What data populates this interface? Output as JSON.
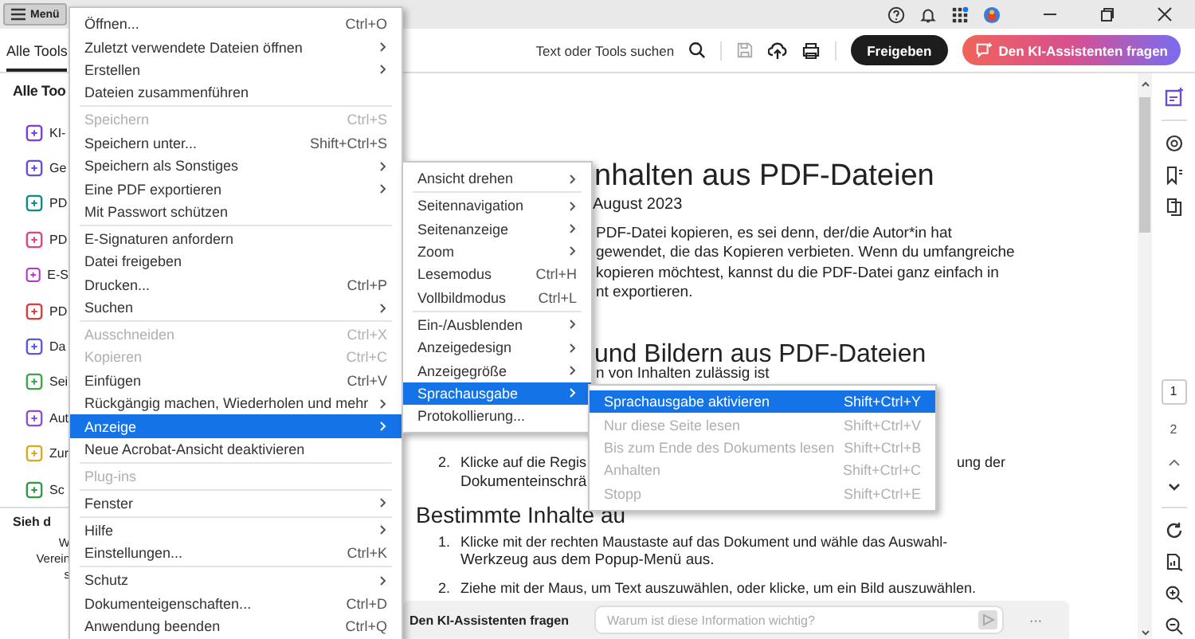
{
  "title_bar": {
    "menu_button": "Menü"
  },
  "toolbar": {
    "tabs": [
      {
        "label": "Alle Tools",
        "selected": true
      }
    ],
    "search": "Text oder Tools suchen",
    "share_button": "Freigeben",
    "ai_button": "Den KI-Assistenten fragen"
  },
  "tools_panel": {
    "heading": "Alle Too",
    "tools": [
      {
        "label": "KI-",
        "color": "#7b3fe4"
      },
      {
        "label": "Ge",
        "color": "#6b4be0"
      },
      {
        "label": "PD",
        "color": "#0d8a8a"
      },
      {
        "label": "PD",
        "color": "#e0457b"
      },
      {
        "label": "E-S",
        "color": "#b136c9"
      },
      {
        "label": "PD",
        "color": "#e03c3c"
      },
      {
        "label": "Da",
        "color": "#5a5ae0"
      },
      {
        "label": "Sei",
        "color": "#3aa84a"
      },
      {
        "label": "Aut",
        "color": "#8a4ee0"
      },
      {
        "label": "Zur",
        "color": "#e0a81a"
      },
      {
        "label": "Sc",
        "color": "#2e9a4a"
      }
    ],
    "promo": {
      "title": "Sieh d",
      "lines": [
        "W",
        "Verein",
        "s"
      ]
    }
  },
  "document": {
    "lines": [
      {
        "kind": "title-tail",
        "text": "nhalten aus PDF-Dateien"
      },
      {
        "kind": "date-tail",
        "text": "August 2023"
      },
      {
        "kind": "para-tail",
        "text": "PDF-Datei kopieren, es sei denn, der/die Autor*in hat"
      },
      {
        "kind": "para-tail",
        "text": "gewendet, die das Kopieren verbieten. Wenn du umfangreiche"
      },
      {
        "kind": "para-tail",
        "text": "kopieren möchtest, kannst du die PDF-Datei ganz einfach in"
      },
      {
        "kind": "para-tail",
        "text": "nt exportieren."
      },
      {
        "kind": "heading-tail",
        "text": "und Bildern aus PDF-Dateien"
      },
      {
        "kind": "para-tail",
        "text": "n von Inhalten zulässig ist"
      },
      {
        "kind": "list-item",
        "number": "2.",
        "parts": [
          "Klicke auf die Regis",
          "ung der"
        ]
      },
      {
        "kind": "list-cont",
        "text": "Dokumenteinschrä"
      },
      {
        "kind": "heading",
        "text": "Bestimmte Inhalte au"
      },
      {
        "kind": "list-item",
        "number": "1.",
        "parts": [
          "Klicke mit der rechten Maustaste auf das Dokument und wähle das Auswahl-"
        ]
      },
      {
        "kind": "list-cont",
        "text": "Werkzeug aus dem Popup-Menü aus."
      },
      {
        "kind": "list-item",
        "number": "2.",
        "parts": [
          "Ziehe mit der Maus, um Text auszuwählen, oder klicke, um ein Bild auszuwählen."
        ]
      }
    ],
    "ai_bar": {
      "label": "Den KI-Assistenten fragen",
      "placeholder": "Warum ist diese Information wichtig?",
      "more": "···"
    }
  },
  "page_nav": {
    "pages": [
      {
        "label": "1",
        "selected": true
      },
      {
        "label": "2",
        "selected": false
      }
    ]
  },
  "menus": [
    {
      "items": [
        {
          "kind": "item",
          "label": "Öffnen...",
          "shortcut": "Ctrl+O",
          "submenu": false,
          "disabled": false,
          "selected": false
        },
        {
          "kind": "item",
          "label": "Zuletzt verwendete Dateien öffnen",
          "submenu": true,
          "disabled": false,
          "selected": false
        },
        {
          "kind": "item",
          "label": "Erstellen",
          "submenu": true,
          "disabled": false,
          "selected": false
        },
        {
          "kind": "item",
          "label": "Dateien zusammenführen",
          "submenu": false,
          "disabled": false,
          "selected": false
        },
        {
          "kind": "separator"
        },
        {
          "kind": "item",
          "label": "Speichern",
          "shortcut": "Ctrl+S",
          "submenu": false,
          "disabled": true,
          "selected": false
        },
        {
          "kind": "item",
          "label": "Speichern unter...",
          "shortcut": "Shift+Ctrl+S",
          "submenu": false,
          "disabled": false,
          "selected": false
        },
        {
          "kind": "item",
          "label": "Speichern als Sonstiges",
          "submenu": true,
          "disabled": false,
          "selected": false
        },
        {
          "kind": "item",
          "label": "Eine PDF exportieren",
          "submenu": true,
          "disabled": false,
          "selected": false
        },
        {
          "kind": "item",
          "label": "Mit Passwort schützen",
          "submenu": false,
          "disabled": false,
          "selected": false
        },
        {
          "kind": "separator"
        },
        {
          "kind": "item",
          "label": "E-Signaturen anfordern",
          "submenu": false,
          "disabled": false,
          "selected": false
        },
        {
          "kind": "item",
          "label": "Datei freigeben",
          "submenu": false,
          "disabled": false,
          "selected": false
        },
        {
          "kind": "item",
          "label": "Drucken...",
          "shortcut": "Ctrl+P",
          "submenu": false,
          "disabled": false,
          "selected": false
        },
        {
          "kind": "item",
          "label": "Suchen",
          "submenu": true,
          "disabled": false,
          "selected": false
        },
        {
          "kind": "separator"
        },
        {
          "kind": "item",
          "label": "Ausschneiden",
          "shortcut": "Ctrl+X",
          "submenu": false,
          "disabled": true,
          "selected": false
        },
        {
          "kind": "item",
          "label": "Kopieren",
          "shortcut": "Ctrl+C",
          "submenu": false,
          "disabled": true,
          "selected": false
        },
        {
          "kind": "item",
          "label": "Einfügen",
          "shortcut": "Ctrl+V",
          "submenu": false,
          "disabled": false,
          "selected": false
        },
        {
          "kind": "item",
          "label": "Rückgängig machen, Wiederholen und mehr",
          "submenu": true,
          "disabled": false,
          "selected": false
        },
        {
          "kind": "item",
          "label": "Anzeige",
          "submenu": true,
          "disabled": false,
          "selected": true
        },
        {
          "kind": "item",
          "label": "Neue Acrobat-Ansicht deaktivieren",
          "submenu": false,
          "disabled": false,
          "selected": false
        },
        {
          "kind": "separator"
        },
        {
          "kind": "item",
          "label": "Plug-ins",
          "submenu": false,
          "disabled": true,
          "selected": false
        },
        {
          "kind": "separator"
        },
        {
          "kind": "item",
          "label": "Fenster",
          "submenu": true,
          "disabled": false,
          "selected": false
        },
        {
          "kind": "separator"
        },
        {
          "kind": "item",
          "label": "Hilfe",
          "submenu": true,
          "disabled": false,
          "selected": false
        },
        {
          "kind": "item",
          "label": "Einstellungen...",
          "shortcut": "Ctrl+K",
          "submenu": false,
          "disabled": false,
          "selected": false
        },
        {
          "kind": "separator"
        },
        {
          "kind": "item",
          "label": "Schutz",
          "submenu": true,
          "disabled": false,
          "selected": false
        },
        {
          "kind": "item",
          "label": "Dokumenteigenschaften...",
          "shortcut": "Ctrl+D",
          "submenu": false,
          "disabled": false,
          "selected": false
        },
        {
          "kind": "item",
          "label": "Anwendung beenden",
          "shortcut": "Ctrl+Q",
          "submenu": false,
          "disabled": false,
          "selected": false
        }
      ]
    },
    {
      "items": [
        {
          "kind": "item",
          "label": "Ansicht drehen",
          "submenu": true,
          "disabled": false,
          "selected": false
        },
        {
          "kind": "separator"
        },
        {
          "kind": "item",
          "label": "Seitennavigation",
          "submenu": true,
          "disabled": false,
          "selected": false
        },
        {
          "kind": "item",
          "label": "Seitenanzeige",
          "submenu": true,
          "disabled": false,
          "selected": false
        },
        {
          "kind": "item",
          "label": "Zoom",
          "submenu": true,
          "disabled": false,
          "selected": false
        },
        {
          "kind": "item",
          "label": "Lesemodus",
          "shortcut": "Ctrl+H",
          "submenu": false,
          "disabled": false,
          "selected": false
        },
        {
          "kind": "item",
          "label": "Vollbildmodus",
          "shortcut": "Ctrl+L",
          "submenu": false,
          "disabled": false,
          "selected": false
        },
        {
          "kind": "separator"
        },
        {
          "kind": "item",
          "label": "Ein-/Ausblenden",
          "submenu": true,
          "disabled": false,
          "selected": false
        },
        {
          "kind": "item",
          "label": "Anzeigedesign",
          "submenu": true,
          "disabled": false,
          "selected": false
        },
        {
          "kind": "item",
          "label": "Anzeigegröße",
          "submenu": true,
          "disabled": false,
          "selected": false
        },
        {
          "kind": "item",
          "label": "Sprachausgabe",
          "submenu": true,
          "disabled": false,
          "selected": true
        },
        {
          "kind": "item",
          "label": "Protokollierung...",
          "submenu": false,
          "disabled": false,
          "selected": false
        }
      ]
    },
    {
      "items": [
        {
          "kind": "item",
          "label": "Sprachausgabe aktivieren",
          "shortcut": "Shift+Ctrl+Y",
          "submenu": false,
          "disabled": false,
          "selected": true
        },
        {
          "kind": "item",
          "label": "Nur diese Seite lesen",
          "shortcut": "Shift+Ctrl+V",
          "submenu": false,
          "disabled": true,
          "selected": false
        },
        {
          "kind": "item",
          "label": "Bis zum Ende des Dokuments lesen",
          "shortcut": "Shift+Ctrl+B",
          "submenu": false,
          "disabled": true,
          "selected": false
        },
        {
          "kind": "item",
          "label": "Anhalten",
          "shortcut": "Shift+Ctrl+C",
          "submenu": false,
          "disabled": true,
          "selected": false
        },
        {
          "kind": "item",
          "label": "Stopp",
          "shortcut": "Shift+Ctrl+E",
          "submenu": false,
          "disabled": true,
          "selected": false
        }
      ]
    }
  ]
}
